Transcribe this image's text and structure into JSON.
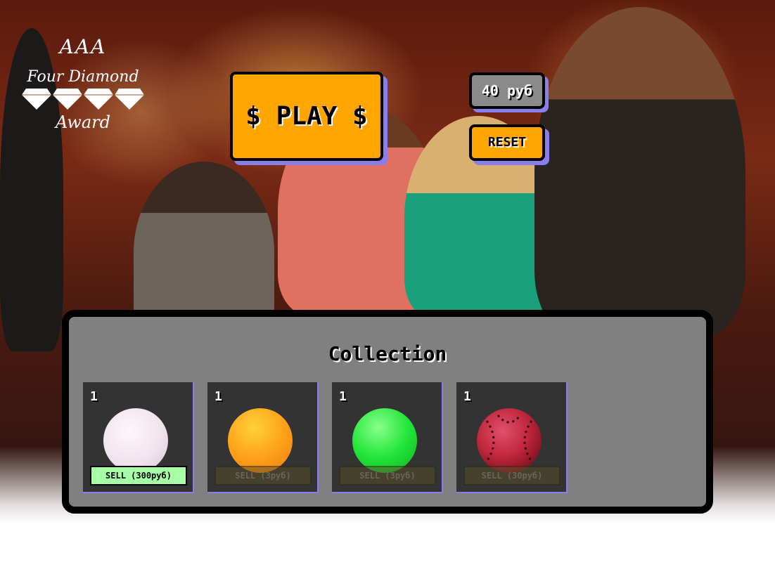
{
  "award": {
    "brand": "AAA",
    "line1": "Four Diamond",
    "line2": "Award",
    "diamond_count": 4
  },
  "controls": {
    "play_label": "$ PLAY $",
    "balance": "40 руб",
    "reset_label": "RESET"
  },
  "collection": {
    "title": "Collection",
    "items": [
      {
        "count": "1",
        "sell_label": "SELL (300руб)",
        "color": "#f0e4ee",
        "enabled": true,
        "icon": "white-ball-icon"
      },
      {
        "count": "1",
        "sell_label": "SELL (3руб)",
        "color": "#ffa21a",
        "enabled": false,
        "icon": "orange-ball-icon"
      },
      {
        "count": "1",
        "sell_label": "SELL (3руб)",
        "color": "#22e63a",
        "enabled": false,
        "icon": "green-ball-icon"
      },
      {
        "count": "1",
        "sell_label": "SELL (30руб)",
        "color": "#c2283e",
        "enabled": false,
        "icon": "baseball-icon"
      }
    ]
  }
}
